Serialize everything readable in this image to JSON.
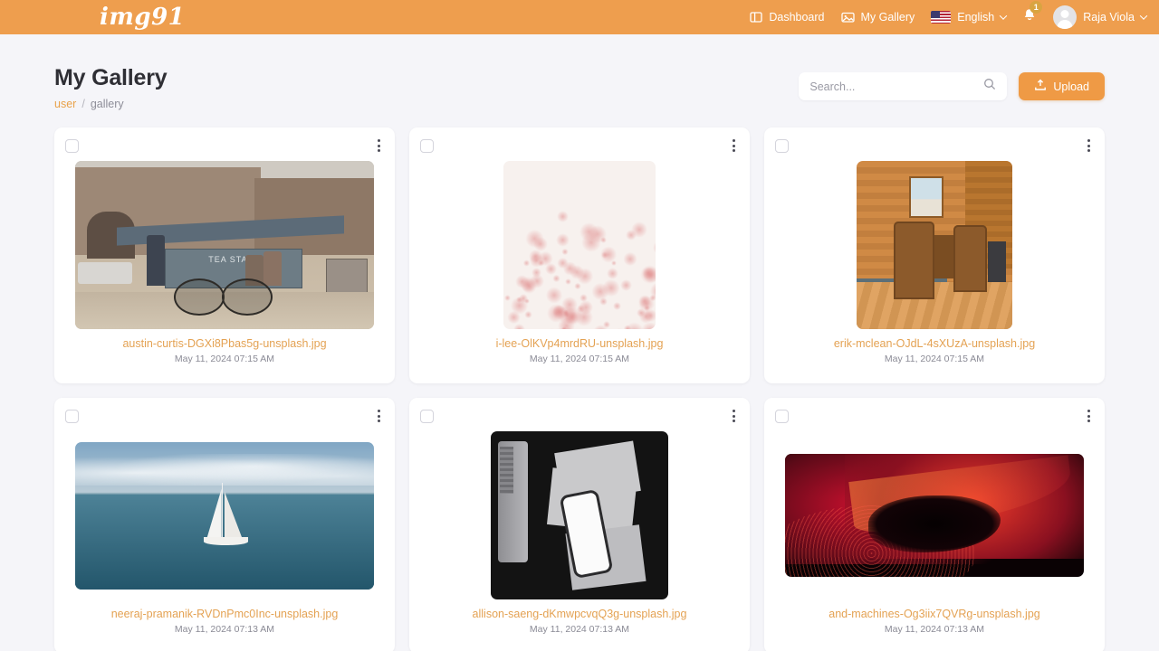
{
  "navbar": {
    "brand": "img91",
    "brand_color": "#ffffff",
    "background_color": "#ee9e4e",
    "links": [
      {
        "label": "Dashboard",
        "icon": "dashboard-icon"
      },
      {
        "label": "My Gallery",
        "icon": "gallery-icon"
      }
    ],
    "language": {
      "label": "English",
      "icon": "us-flag-icon"
    },
    "notifications": {
      "count": "1",
      "icon": "bell-icon"
    },
    "user": {
      "name": "Raja Viola",
      "icon": "avatar-icon"
    }
  },
  "page": {
    "title": "My Gallery",
    "breadcrumb": {
      "root": "user",
      "separator": "/",
      "current": "gallery"
    }
  },
  "toolbar": {
    "search": {
      "placeholder": "Search...",
      "value": "",
      "icon": "search-icon"
    },
    "upload": {
      "label": "Upload",
      "icon": "upload-icon",
      "color": "#ef9a45"
    }
  },
  "gallery": {
    "items": [
      {
        "filename": "austin-curtis-DGXi8Pbas5g-unsplash.jpg",
        "date": "May 11, 2024 07:15 AM",
        "art": "tea",
        "thumb_w": 330,
        "thumb_h": 186,
        "alt": "street tea stall with cart"
      },
      {
        "filename": "i-lee-OlKVp4mrdRU-unsplash.jpg",
        "date": "May 11, 2024 07:15 AM",
        "art": "blossom",
        "thumb_w": 168,
        "thumb_h": 186,
        "alt": "pink cherry blossom branches"
      },
      {
        "filename": "erik-mclean-OJdL-4sXUzA-unsplash.jpg",
        "date": "May 11, 2024 07:15 AM",
        "art": "cabin",
        "thumb_w": 172,
        "thumb_h": 186,
        "alt": "wooden cabin interior with chairs"
      },
      {
        "filename": "neeraj-pramanik-RVDnPmc0Inc-unsplash.jpg",
        "date": "May 11, 2024 07:13 AM",
        "art": "sail",
        "thumb_w": 330,
        "thumb_h": 163,
        "alt": "sailboat on open sea"
      },
      {
        "filename": "allison-saeng-dKmwpcvqQ3g-unsplash.jpg",
        "date": "May 11, 2024 07:13 AM",
        "art": "desk",
        "thumb_w": 196,
        "thumb_h": 186,
        "alt": "dark desk flatlay with phone and papers"
      },
      {
        "filename": "and-machines-Og3iix7QVRg-unsplash.jpg",
        "date": "May 11, 2024 07:13 AM",
        "art": "wave",
        "thumb_w": 330,
        "thumb_h": 136,
        "alt": "red abstract wave"
      }
    ]
  }
}
